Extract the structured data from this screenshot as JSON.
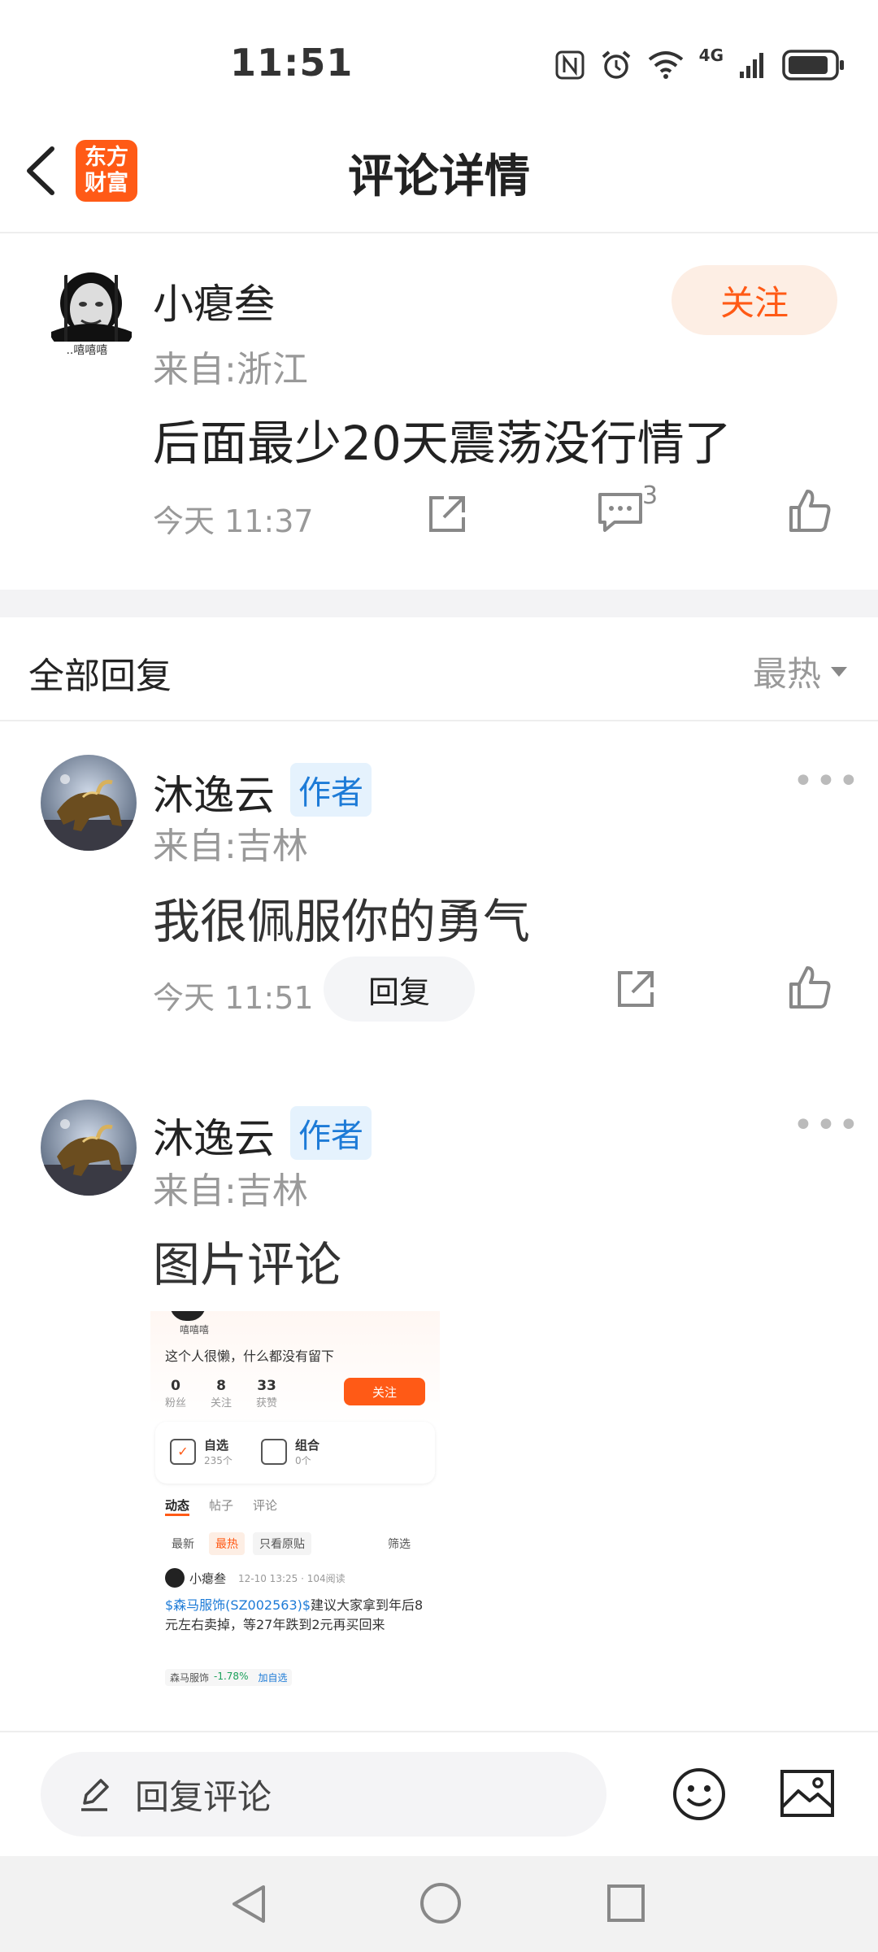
{
  "status": {
    "time": "11:51",
    "network": "4G"
  },
  "nav": {
    "title": "评论详情",
    "logo_line1": "东方",
    "logo_line2": "财富"
  },
  "comment": {
    "user": "小瘪叁",
    "avatar_caption": "...嘻嘻嘻",
    "location": "来自:浙江",
    "content": "后面最少20天震荡没行情了",
    "time": "今天 11:37",
    "reply_count": "3",
    "follow_label": "关注"
  },
  "replies_header": {
    "title": "全部回复",
    "sort": "最热"
  },
  "replies": [
    {
      "user": "沐逸云",
      "tag": "作者",
      "location": "来自:吉林",
      "content": "我很佩服你的勇气",
      "time": "今天 11:51",
      "reply_label": "回复"
    },
    {
      "user": "沐逸云",
      "tag": "作者",
      "location": "来自:吉林",
      "content": "图片评论"
    }
  ],
  "image_preview": {
    "caption": "嘻嘻嘻",
    "bio": "这个人很懒，什么都没有留下",
    "stats": [
      {
        "value": "0",
        "label": "粉丝"
      },
      {
        "value": "8",
        "label": "关注"
      },
      {
        "value": "33",
        "label": "获赞"
      }
    ],
    "follow": "关注",
    "cards": [
      {
        "title": "自选",
        "sub": "235个"
      },
      {
        "title": "组合",
        "sub": "0个"
      }
    ],
    "tabs": [
      "动态",
      "帖子",
      "评论"
    ],
    "filters": [
      "最新",
      "最热",
      "只看原贴"
    ],
    "filter_btn": "筛选",
    "post_user": "小瘪叁",
    "post_meta": "12-10 13:25 · 104阅读",
    "post_stock": "$森马服饰(SZ002563)$",
    "post_text": "建议大家拿到年后8元左右卖掉，等27年跌到2元再买回来",
    "stock_name": "森马服饰",
    "stock_change": "-1.78%",
    "add_watch": "加自选"
  },
  "bottom": {
    "input_placeholder": "回复评论"
  },
  "colors": {
    "accent": "#ff5a16",
    "author_tag": "#1d7bd7",
    "stock_down": "#1aa05a"
  }
}
